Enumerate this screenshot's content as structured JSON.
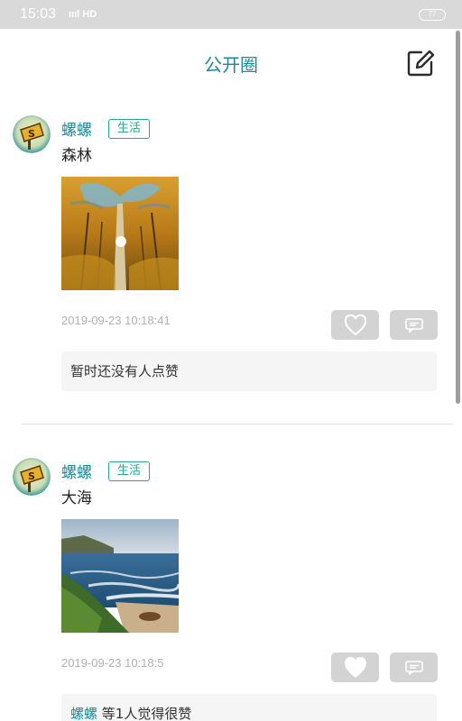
{
  "status_bar": {
    "time": "15:03",
    "signal": "ıııl HD",
    "battery": "77"
  },
  "header": {
    "title": "公开圈"
  },
  "posts": [
    {
      "username": "螺螺",
      "tag": "生活",
      "text": "森林",
      "image": "forest-photo",
      "timestamp": "2019-09-23 10:18:41",
      "likes_text": "暂时还没有人点赞",
      "liked": false
    },
    {
      "username": "螺螺",
      "tag": "生活",
      "text": "大海",
      "image": "sea-photo",
      "timestamp": "2019-09-23 10:18:5",
      "likes_user": "螺螺",
      "likes_text": " 等1人觉得很赞",
      "liked": true
    }
  ],
  "icons": [
    "edit-icon",
    "heart-outline-icon",
    "heart-filled-icon",
    "comment-icon"
  ],
  "colors": {
    "accent": "#1a8a9a",
    "tag": "#2aa58f",
    "button_bg": "#d3d3d3",
    "timestamp": "#b0b0b0"
  }
}
